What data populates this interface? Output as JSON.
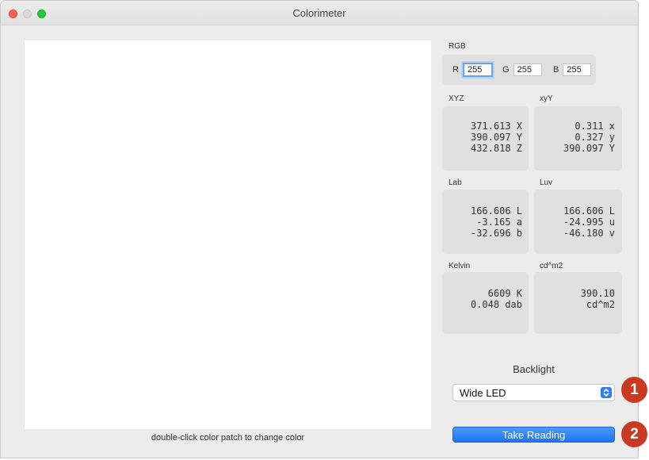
{
  "window": {
    "title": "Colorimeter"
  },
  "patch": {
    "hint": "double-click color patch to change color"
  },
  "rgb": {
    "label": "RGB",
    "r_letter": "R",
    "r_value": "255",
    "g_letter": "G",
    "g_value": "255",
    "b_letter": "B",
    "b_value": "255"
  },
  "xyz": {
    "label": "XYZ",
    "lines": [
      "371.613 X",
      "390.097 Y",
      "432.818 Z"
    ]
  },
  "xyY": {
    "label": "xyY",
    "lines": [
      "0.311 x",
      "0.327 y",
      "390.097 Y"
    ]
  },
  "lab": {
    "label": "Lab",
    "lines": [
      "166.606 L",
      "-3.165 a",
      "-32.696 b"
    ]
  },
  "luv": {
    "label": "Luv",
    "lines": [
      "166.606 L",
      "-24.995 u",
      "-46.180 v"
    ]
  },
  "kelvin": {
    "label": "Kelvin",
    "lines": [
      "6609 K",
      "0.048 dab"
    ]
  },
  "cdm2": {
    "label": "cd^m2",
    "lines": [
      "390.10",
      "cd^m2"
    ]
  },
  "backlight": {
    "label": "Backlight",
    "selected": "Wide LED"
  },
  "take_reading": {
    "label": "Take Reading"
  },
  "badges": {
    "one": "1",
    "two": "2"
  },
  "colors": {
    "accent": "#1e74f0",
    "badge": "#c93a22"
  }
}
